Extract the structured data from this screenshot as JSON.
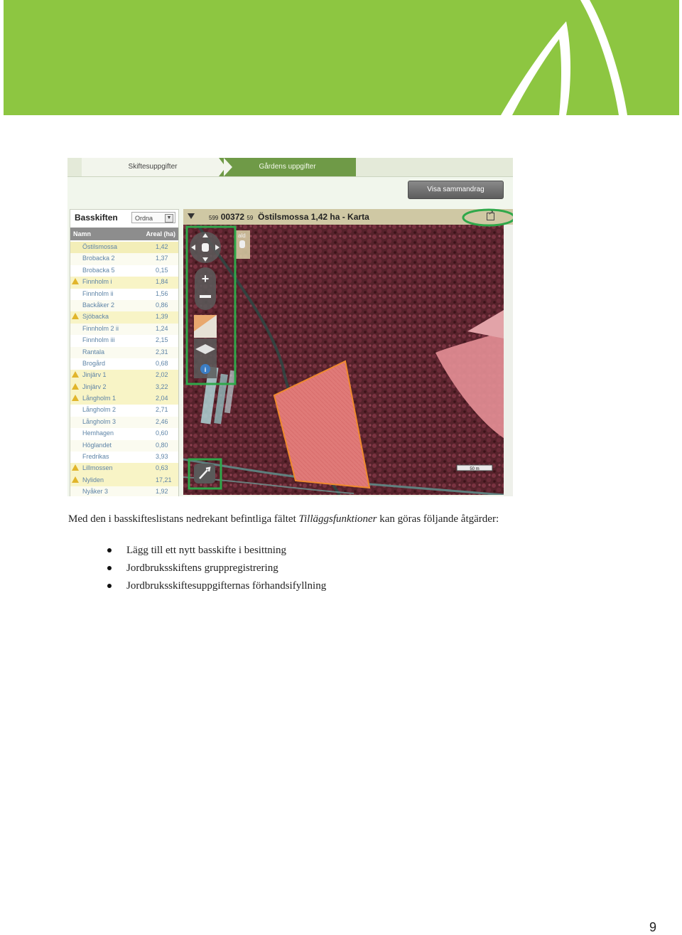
{
  "screenshot": {
    "tabs": [
      "Skiftesuppgifter",
      "Gårdens uppgifter"
    ],
    "summary_button": "Visa sammandrag",
    "list": {
      "title": "Basskiften",
      "sort_value": "Ordna",
      "columns": [
        "Namn",
        "Areal (ha)"
      ],
      "rows": [
        {
          "name": "Östilsmossa",
          "area": "1,42",
          "warning": false,
          "selected": true
        },
        {
          "name": "Brobacka 2",
          "area": "1,37",
          "warning": false,
          "selected": false
        },
        {
          "name": "Brobacka 5",
          "area": "0,15",
          "warning": false,
          "selected": false
        },
        {
          "name": "Finnholm i",
          "area": "1,84",
          "warning": true,
          "selected": false
        },
        {
          "name": "Finnholm ii",
          "area": "1,56",
          "warning": false,
          "selected": false
        },
        {
          "name": "Backåker 2",
          "area": "0,86",
          "warning": false,
          "selected": false
        },
        {
          "name": "Sjöbacka",
          "area": "1,39",
          "warning": true,
          "selected": false
        },
        {
          "name": "Finnholm 2 ii",
          "area": "1,24",
          "warning": false,
          "selected": false
        },
        {
          "name": "Finnholm iii",
          "area": "2,15",
          "warning": false,
          "selected": false
        },
        {
          "name": "Rantala",
          "area": "2,31",
          "warning": false,
          "selected": false
        },
        {
          "name": "Brogård",
          "area": "0,68",
          "warning": false,
          "selected": false
        },
        {
          "name": "Jinjärv 1",
          "area": "2,02",
          "warning": true,
          "selected": false
        },
        {
          "name": "Jinjärv 2",
          "area": "3,22",
          "warning": true,
          "selected": false
        },
        {
          "name": "Långholm 1",
          "area": "2,04",
          "warning": true,
          "selected": false
        },
        {
          "name": "Långholm 2",
          "area": "2,71",
          "warning": false,
          "selected": false
        },
        {
          "name": "Långholm 3",
          "area": "2,46",
          "warning": false,
          "selected": false
        },
        {
          "name": "Hemhagen",
          "area": "0,60",
          "warning": false,
          "selected": false
        },
        {
          "name": "Höglandet",
          "area": "0,80",
          "warning": false,
          "selected": false
        },
        {
          "name": "Fredrikas",
          "area": "3,93",
          "warning": false,
          "selected": false
        },
        {
          "name": "Lillmossen",
          "area": "0,63",
          "warning": true,
          "selected": false
        },
        {
          "name": "Nyliden",
          "area": "17,21",
          "warning": true,
          "selected": false
        },
        {
          "name": "Nyåker 3",
          "area": "1,92",
          "warning": false,
          "selected": false
        }
      ]
    },
    "map": {
      "id_small_left": "599",
      "id_main": "00372",
      "id_small_right": "59",
      "title": "Östilsmossa 1,42 ha - Karta",
      "layer_label": "ald",
      "scale": "50 m",
      "highlight_color": "#2fa84a"
    }
  },
  "text": {
    "intro_before": "Med den i basskifteslistans nedrekant befintliga fältet ",
    "intro_italic": "Tilläggsfunktioner",
    "intro_after": " kan göras följande åtgärder:",
    "bullets": [
      "Lägg till ett nytt basskifte i besittning",
      "Jordbruksskiftens gruppregistrering",
      "Jordbruksskiftesuppgifternas förhandsifyllning"
    ]
  },
  "page_number": "9",
  "colors": {
    "banner": "#8dc641"
  }
}
